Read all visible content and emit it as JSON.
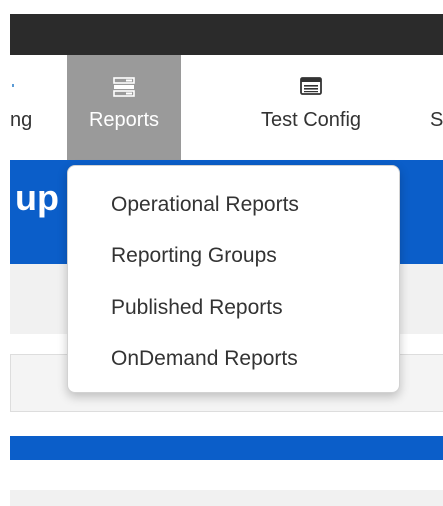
{
  "nav": {
    "tabs": [
      {
        "label": "ng",
        "icon": "partial-icon"
      },
      {
        "label": "Reports",
        "icon": "reports-list-icon",
        "active": true
      },
      {
        "label": "Test Config",
        "icon": "window-icon"
      },
      {
        "label": "S",
        "icon": ""
      }
    ]
  },
  "page": {
    "title_partial": "up"
  },
  "reports_menu": {
    "items": [
      {
        "label": "Operational Reports"
      },
      {
        "label": "Reporting Groups"
      },
      {
        "label": "Published Reports"
      },
      {
        "label": "OnDemand Reports"
      }
    ]
  },
  "colors": {
    "top_bar": "#2b2b2b",
    "active_tab": "#9a9a9a",
    "brand_blue": "#0b5ec9",
    "panel_grey": "#f1f1f1",
    "text_dark": "#333333"
  }
}
